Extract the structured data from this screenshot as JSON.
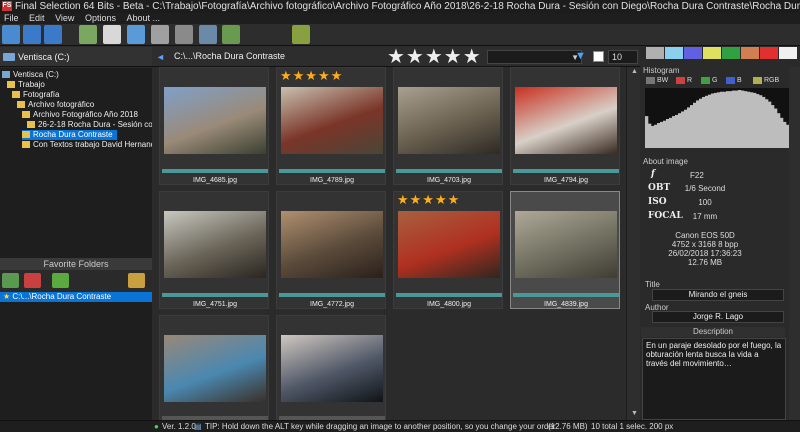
{
  "window": {
    "title": "Final Selection 64 Bits - Beta - C:\\Trabajo\\Fotografía\\Archivo fotográfico\\Archivo Fotográfico Año 2018\\26-2-18 Rocha Dura - Sesión con Diego\\Rocha Dura Contraste\\Rocha Dura Orden Final.fsp *",
    "app_icon_text": "FS"
  },
  "menu": [
    "File",
    "Edit",
    "View",
    "Options",
    "About ..."
  ],
  "drive": {
    "label": "Ventisca (C:)"
  },
  "tree": [
    {
      "label": "Ventisca (C:)",
      "depth": 0
    },
    {
      "label": "Trabajo",
      "depth": 1
    },
    {
      "label": "Fotografía",
      "depth": 2
    },
    {
      "label": "Archivo fotográfico",
      "depth": 3
    },
    {
      "label": "Archivo Fotográfico Año 2018",
      "depth": 4
    },
    {
      "label": "26-2-18 Rocha Dura - Sesión con Diego",
      "depth": 5
    },
    {
      "label": "Rocha Dura Contraste",
      "depth": 6,
      "selected": true
    },
    {
      "label": "Con Textos trabajo David Hernandez",
      "depth": 6
    }
  ],
  "favorites": {
    "header": "Favorite Folders",
    "items": [
      "C:\\...\\Rocha Dura Contraste"
    ]
  },
  "pathbar": {
    "back": "◄",
    "path": "C:\\...\\Rocha Dura Contraste",
    "star_filter": "★★★★★",
    "count": "10"
  },
  "thumbnails": [
    {
      "name": "IMG_4685.jpg",
      "stars": "",
      "colors": [
        "#7fa0c8",
        "#9a8a78",
        "#3b4030"
      ]
    },
    {
      "name": "IMG_4789.jpg",
      "stars": "★★★★★",
      "colors": [
        "#c8c0b0",
        "#7a3528",
        "#4a4638"
      ]
    },
    {
      "name": "IMG_4703.jpg",
      "stars": "",
      "colors": [
        "#a8a090",
        "#6a6050",
        "#2d2a24"
      ]
    },
    {
      "name": "IMG_4794.jpg",
      "stars": "",
      "colors": [
        "#c83020",
        "#d8d0c8",
        "#3a2a20"
      ]
    },
    {
      "name": "IMG_4751.jpg",
      "stars": "",
      "colors": [
        "#c8c8c0",
        "#6a6458",
        "#2a2620"
      ]
    },
    {
      "name": "IMG_4772.jpg",
      "stars": "",
      "colors": [
        "#b09070",
        "#5a4a3a",
        "#2a201a"
      ]
    },
    {
      "name": "IMG_4800.jpg",
      "stars": "★★★★★",
      "colors": [
        "#a86040",
        "#b03020",
        "#302620"
      ]
    },
    {
      "name": "IMG_4839.jpg",
      "stars": "",
      "colors": [
        "#b0a898",
        "#707060",
        "#403c34"
      ],
      "selected": true
    },
    {
      "name": "",
      "stars": "",
      "colors": [
        "#988878",
        "#4a88b0",
        "#3a3028"
      ]
    },
    {
      "name": "",
      "stars": "",
      "colors": [
        "#d0c8c0",
        "#505868",
        "#101418"
      ]
    }
  ],
  "histogram": {
    "label": "Histogram",
    "tabs": [
      "BW",
      "R",
      "G",
      "B",
      "RGB"
    ],
    "levels": [
      0.55,
      0.42,
      0.38,
      0.4,
      0.43,
      0.45,
      0.47,
      0.5,
      0.52,
      0.55,
      0.57,
      0.6,
      0.63,
      0.66,
      0.7,
      0.74,
      0.78,
      0.82,
      0.85,
      0.88,
      0.9,
      0.92,
      0.94,
      0.95,
      0.96,
      0.97,
      0.97,
      0.98,
      0.98,
      0.99,
      0.99,
      1.0,
      0.99,
      0.98,
      0.97,
      0.96,
      0.95,
      0.93,
      0.91,
      0.88,
      0.84,
      0.8,
      0.74,
      0.68,
      0.6,
      0.52,
      0.45,
      0.4,
      0.38,
      0.3
    ]
  },
  "about": {
    "label": "About image",
    "rows": [
      {
        "key": "f",
        "value": "F22"
      },
      {
        "key": "OBT",
        "value": "1/6 Second"
      },
      {
        "key": "ISO",
        "value": "100"
      },
      {
        "key": "FOCAL",
        "value": "17 mm"
      }
    ],
    "camera": "Canon EOS 50D",
    "dimensions": "4752 x 3168 8 bpp",
    "date": "26/02/2018 17:36:23",
    "size": "12.76 MB"
  },
  "title_label": "Title",
  "title_value": "Mirando el gneis",
  "author_label": "Author",
  "author_value": "Jorge R. Lago",
  "description_label": "Description",
  "description_value": "En un paraje desolado por el fuego, la obturación lenta busca la vida a través del movimiento…",
  "swatches": [
    "#b0b0b0",
    "#8cd0f0",
    "#6060e0",
    "#e0e060",
    "#30a040",
    "#d08050",
    "#e03030",
    "#f0f0f0"
  ],
  "status": {
    "version": "Ver. 1.2.0",
    "tip": "TIP: Hold down the ALT key while dragging an image to another position, so you change your order.",
    "filesize": "(12.76 MB)",
    "counts": "10 total 1 selec. 200 px"
  }
}
